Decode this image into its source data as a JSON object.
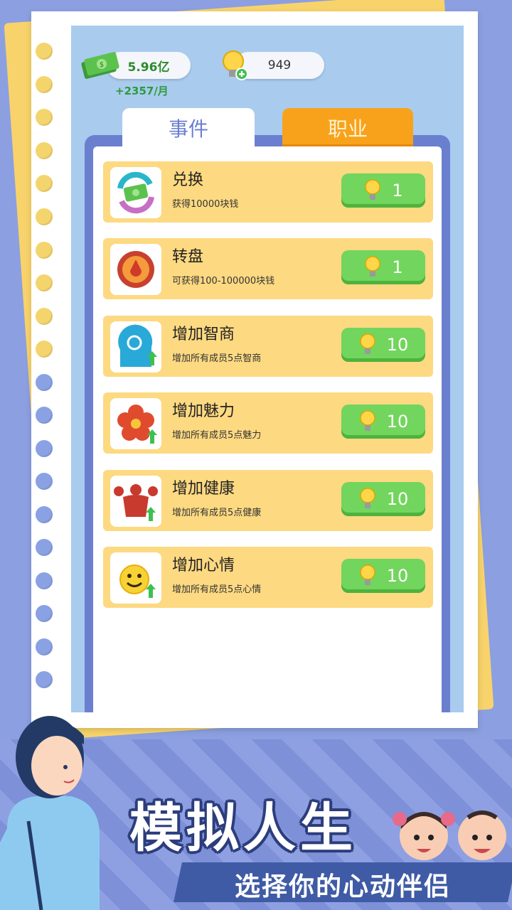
{
  "header": {
    "cash": "5.96亿",
    "cash_monthly": "+2357/月",
    "bulbs": "949"
  },
  "tabs": [
    {
      "label": "事件",
      "active": true
    },
    {
      "label": "职业",
      "active": false
    }
  ],
  "events": [
    {
      "title": "兑换",
      "desc": "获得10000块钱",
      "cost": "1",
      "icon": "money-exchange-icon"
    },
    {
      "title": "转盘",
      "desc": "可获得100-100000块钱",
      "cost": "1",
      "icon": "wheel-icon"
    },
    {
      "title": "增加智商",
      "desc": "增加所有成员5点智商",
      "cost": "10",
      "icon": "brain-icon"
    },
    {
      "title": "增加魅力",
      "desc": "增加所有成员5点魅力",
      "cost": "10",
      "icon": "flower-icon"
    },
    {
      "title": "增加健康",
      "desc": "增加所有成员5点健康",
      "cost": "10",
      "icon": "muscle-icon"
    },
    {
      "title": "增加心情",
      "desc": "增加所有成员5点心情",
      "cost": "10",
      "icon": "smiley-icon"
    }
  ],
  "banner": {
    "title": "模拟人生",
    "subtitle": "选择你的心动伴侣"
  },
  "colors": {
    "accent_orange": "#f8a21b",
    "button_green": "#72d55d",
    "card_yellow": "#fdd981",
    "panel_blue": "#6b7fcf"
  }
}
